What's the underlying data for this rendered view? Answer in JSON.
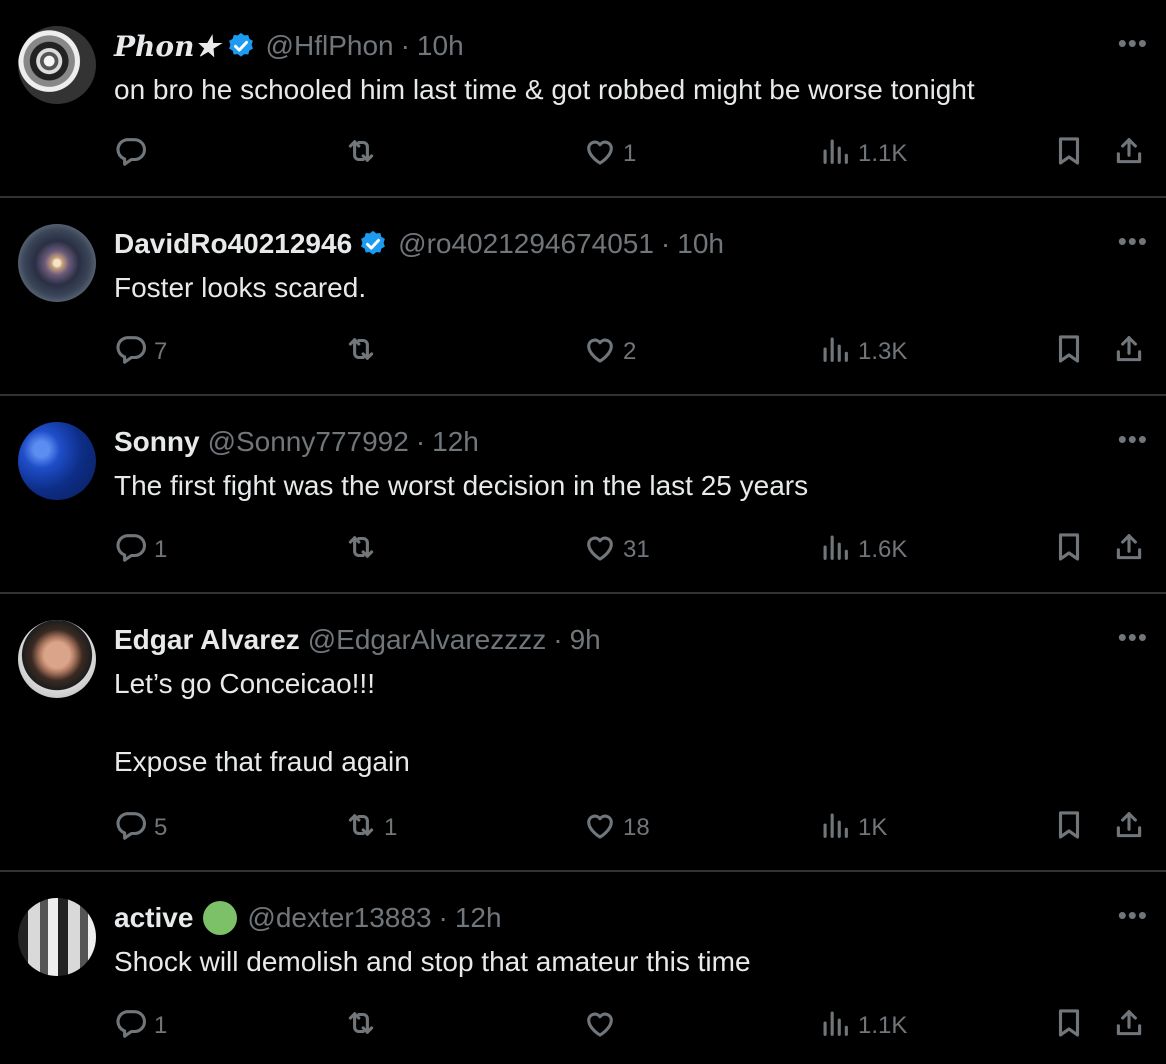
{
  "tweets": [
    {
      "name": "Phon★",
      "fancy": true,
      "badge": "verified",
      "handle": "@HflPhon",
      "sep": "·",
      "time": "10h",
      "text": [
        "on bro he schooled him last time & got robbed might be worse tonight"
      ],
      "replies": "",
      "retweets": "",
      "likes": "1",
      "views": "1.1K",
      "avatar_style": "stadium"
    },
    {
      "name": "DavidRo40212946",
      "badge": "verified",
      "handle": "@ro4021294674051",
      "sep": "·",
      "time": "10h",
      "text": [
        "Foster looks scared."
      ],
      "replies": "7",
      "retweets": "",
      "likes": "2",
      "views": "1.3K",
      "avatar_style": "galaxy"
    },
    {
      "name": "Sonny",
      "badge": "",
      "handle": "@Sonny777992",
      "sep": "·",
      "time": "12h",
      "text": [
        "The first fight was the worst decision in the last 25 years"
      ],
      "replies": "1",
      "retweets": "",
      "likes": "31",
      "views": "1.6K",
      "avatar_style": "blue-sky"
    },
    {
      "name": "Edgar Alvarez",
      "badge": "",
      "handle": "@EdgarAlvarezzzz",
      "sep": "·",
      "time": "9h",
      "text": [
        "Let’s go Conceicao!!!",
        "",
        "Expose that fraud again"
      ],
      "replies": "5",
      "retweets": "1",
      "likes": "18",
      "views": "1K",
      "avatar_style": "face"
    },
    {
      "name": "active",
      "badge": "green",
      "handle": "@dexter13883",
      "sep": "·",
      "time": "12h",
      "text": [
        "Shock will demolish and stop that amateur this time"
      ],
      "replies": "1",
      "retweets": "",
      "likes": "",
      "views": "1.1K",
      "avatar_style": "corridor"
    }
  ],
  "icons": {
    "more": "more-icon",
    "reply": "reply-icon",
    "retweet": "retweet-icon",
    "like": "heart-icon",
    "views": "views-icon",
    "bookmark": "bookmark-icon",
    "share": "share-icon"
  },
  "colors": {
    "background": "#000000",
    "text": "#e7e9ea",
    "muted": "#71767b",
    "divider": "#2f3336",
    "verified": "#1d9bf0",
    "green_badge": "#7cc068"
  }
}
